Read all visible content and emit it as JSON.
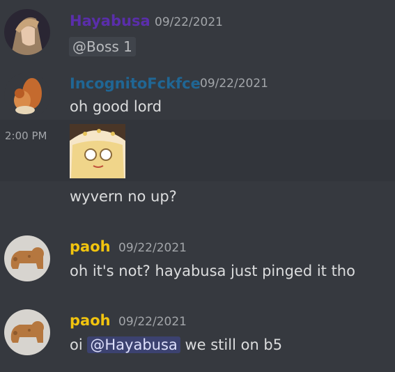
{
  "messages": [
    {
      "author": "Hayabusa",
      "author_color": "#5a2eab",
      "timestamp": "09/22/2021",
      "mention": "@Boss 1"
    },
    {
      "author": "IncognitoFckfce",
      "author_color": "#206694",
      "timestamp": "09/22/2021",
      "text": "oh good lord"
    },
    {
      "side_time": "2:00 PM",
      "emote_name": "emote-image"
    },
    {
      "text": "wyvern no up?"
    },
    {
      "author": "paoh",
      "author_color": "#f1c40f",
      "timestamp": "09/22/2021",
      "text": "oh it's not? hayabusa just pinged it tho"
    },
    {
      "author": "paoh",
      "author_color": "#f1c40f",
      "timestamp": "09/22/2021",
      "text_before": "oi",
      "mention": "@Hayabusa",
      "text_after": "we still on b5"
    }
  ]
}
